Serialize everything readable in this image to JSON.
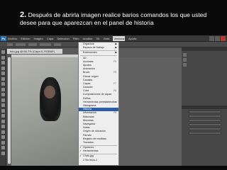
{
  "slide": {
    "title_number": "2.",
    "title_text": "Después de abrirla imagen realice barios comandos los que usted desee para que aparezcan en el panel de historia"
  },
  "app": {
    "logo": "Ps",
    "menubar": [
      "Archivo",
      "Edición",
      "Imagen",
      "Capa",
      "Selección",
      "Filtro",
      "Análisis",
      "3D",
      "Vista",
      "Ventana",
      "Ayuda"
    ],
    "active_menu": "Ventana"
  },
  "document": {
    "tab_title": "foto.jpg @ 66,7% (Capa 0, RGB/8*)"
  },
  "window_menu": {
    "items": [
      {
        "label": "Organizar",
        "arrow": true
      },
      {
        "label": "Espacio de trabajo",
        "arrow": true
      },
      {
        "sep": true
      },
      {
        "label": "Extensiones",
        "arrow": true
      },
      {
        "sep": true
      },
      {
        "label": "3D"
      },
      {
        "label": "Acciones",
        "shortcut": "F9"
      },
      {
        "label": "Ajustes"
      },
      {
        "label": "Animación"
      },
      {
        "label": "Bruch",
        "shortcut": "F5"
      },
      {
        "label": "Clonar origen"
      },
      {
        "label": "Canales"
      },
      {
        "label": "Capas",
        "shortcut": "F7"
      },
      {
        "label": "Carácter"
      },
      {
        "label": "Color",
        "shortcut": "F6"
      },
      {
        "label": "Composiciones de capas"
      },
      {
        "label": "Estilos"
      },
      {
        "label": "Herramientas preestablecidas"
      },
      {
        "label": "Histograma"
      },
      {
        "label": "Historia",
        "highlight": true
      },
      {
        "label": "Información",
        "shortcut": "F8"
      },
      {
        "label": "Máscaras"
      },
      {
        "label": "Muestras"
      },
      {
        "label": "Navegador"
      },
      {
        "label": "Notas"
      },
      {
        "label": "Origen de clonación"
      },
      {
        "label": "Párrafo"
      },
      {
        "label": "Registro de medidas"
      },
      {
        "label": "Trazados"
      },
      {
        "sep": true
      },
      {
        "label": "Opciones",
        "check": true
      },
      {
        "label": "Herramientas",
        "check": true
      },
      {
        "sep": true
      },
      {
        "label": "1 foto.jpg",
        "check": true
      },
      {
        "label": "2 Sin título-1"
      }
    ]
  },
  "colors": {
    "slide_bg": "#0a0a0a",
    "menu_highlight": "#2c5ea8",
    "app_bg": "#545454"
  }
}
